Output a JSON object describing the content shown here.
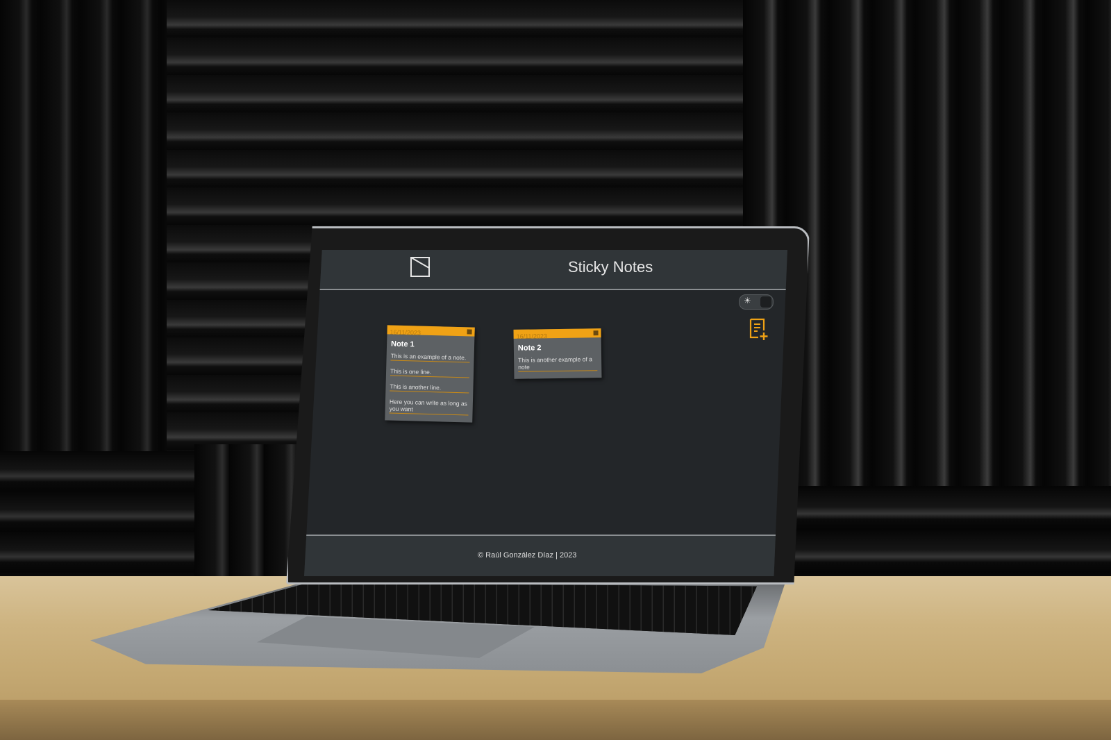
{
  "app": {
    "title": "Sticky Notes",
    "icons": {
      "logo": "sticky-note-icon",
      "theme_toggle": "sun-icon",
      "add_note": "add-note-icon"
    },
    "colors": {
      "accent": "#f0a215",
      "header_bg": "#303538",
      "body_bg": "#232629",
      "note_bg": "#5d6164"
    }
  },
  "notes": [
    {
      "date": "16/11/2023",
      "title": "Note 1",
      "lines": [
        "This is an example of a note.",
        "This is one line.",
        "This is another line.",
        "Here you can write as long as you want"
      ]
    },
    {
      "date": "16/11/2023",
      "title": "Note 2",
      "lines": [
        "This is another example of a note"
      ]
    }
  ],
  "footer": {
    "text": "© Raúl González Díaz | 2023"
  }
}
